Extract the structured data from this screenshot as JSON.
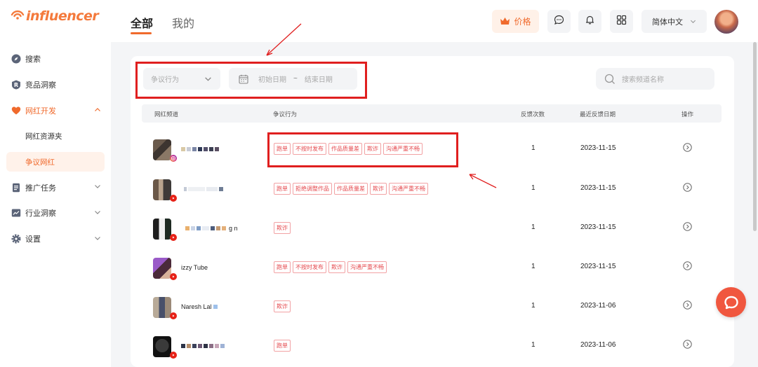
{
  "brand": {
    "logo_text": "influencer",
    "accent": "#f06a2c"
  },
  "sidebar": {
    "items": [
      {
        "label": "搜索",
        "icon": "compass-icon"
      },
      {
        "label": "竞品洞察",
        "icon": "r-badge-icon"
      },
      {
        "label": "网红开发",
        "icon": "heart-icon",
        "expanded": true,
        "children": [
          {
            "label": "网红资源夹"
          },
          {
            "label": "争议网红",
            "active": true
          }
        ]
      },
      {
        "label": "推广任务",
        "icon": "document-icon"
      },
      {
        "label": "行业洞察",
        "icon": "chart-icon"
      },
      {
        "label": "设置",
        "icon": "gear-icon"
      }
    ]
  },
  "header": {
    "tabs": [
      {
        "label": "全部",
        "active": true
      },
      {
        "label": "我的"
      }
    ],
    "price_label": "价格",
    "language": "简体中文"
  },
  "filters": {
    "dispute_placeholder": "争议行为",
    "start_date_placeholder": "初始日期",
    "range_sep": "~",
    "end_date_placeholder": "结束日期",
    "search_placeholder": "搜索频道名称"
  },
  "table": {
    "columns": {
      "channel": "网红频道",
      "dispute": "争议行为",
      "count": "反馈次数",
      "date": "最近反馈日期",
      "action": "操作"
    },
    "rows": [
      {
        "platform": "instagram",
        "name_text": "",
        "tags": [
          "跑单",
          "不按时发布",
          "作品质量差",
          "欺诈",
          "沟通严重不畅"
        ],
        "count": "1",
        "date": "2023-11-15"
      },
      {
        "platform": "youtube",
        "name_text": "",
        "tags": [
          "跑单",
          "拒绝调整作品",
          "作品质量差",
          "欺诈",
          "沟通严重不畅"
        ],
        "count": "1",
        "date": "2023-11-15"
      },
      {
        "platform": "youtube",
        "name_text": "g  n",
        "tags": [
          "欺诈"
        ],
        "count": "1",
        "date": "2023-11-15"
      },
      {
        "platform": "youtube",
        "name_text": "izzy Tube",
        "tags": [
          "跑单",
          "不按时发布",
          "欺诈",
          "沟通严重不畅"
        ],
        "count": "1",
        "date": "2023-11-15"
      },
      {
        "platform": "youtube",
        "name_text": "Naresh Lal",
        "tags": [
          "欺诈"
        ],
        "count": "1",
        "date": "2023-11-06"
      },
      {
        "platform": "youtube",
        "name_text": "",
        "tags": [
          "跑单"
        ],
        "count": "1",
        "date": "2023-11-06"
      }
    ]
  }
}
